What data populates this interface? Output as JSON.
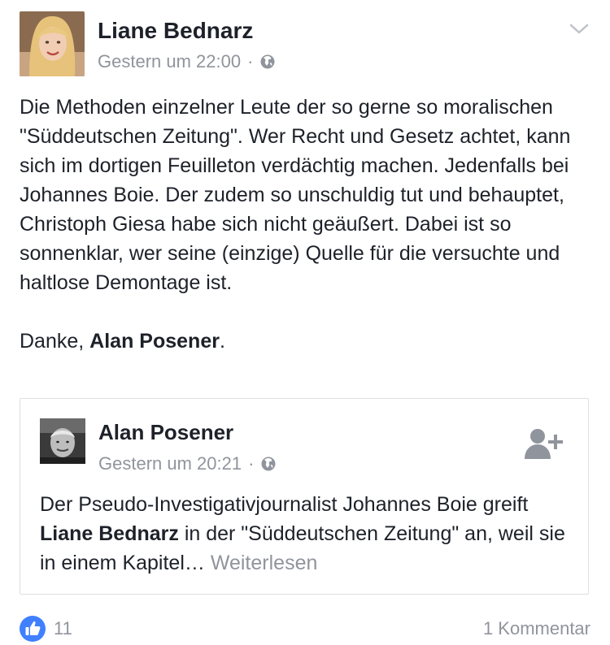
{
  "post": {
    "author": "Liane Bednarz",
    "timestamp": "Gestern um 22:00",
    "separator": "·",
    "privacy_icon": "globe-icon",
    "menu_icon": "chevron-down-icon",
    "body_paragraph_1": "Die Methoden einzelner Leute der so gerne so moralischen \"Süddeutschen Zeitung\". Wer Recht und Gesetz achtet, kann sich im dortigen Feuilleton verdächtig machen. Jedenfalls bei Johannes Boie. Der zudem so unschuldig tut und behauptet, Christoph Giesa habe sich nicht geäußert. Dabei ist so sonnenklar, wer seine (einzige) Quelle für die versuchte und haltlose Demontage ist.",
    "thanks_prefix": "Danke, ",
    "thanks_mention": "Alan Posener",
    "thanks_suffix": "."
  },
  "shared": {
    "author": "Alan Posener",
    "timestamp": "Gestern um 20:21",
    "separator": "·",
    "privacy_icon": "globe-icon",
    "add_friend_icon": "add-friend-icon",
    "text_prefix": "Der Pseudo-Investigativjournalist Johannes Boie greift ",
    "text_mention": "Liane Bednarz",
    "text_suffix": " in der \"Süddeutschen Zeitung\" an, weil sie in einem Kapitel… ",
    "see_more": "Weiterlesen"
  },
  "footer": {
    "like_icon": "thumbs-up-icon",
    "like_count": "11",
    "comment_count": "1 Kommentar"
  },
  "colors": {
    "text": "#1d2129",
    "secondary": "#90949c",
    "like_blue": "#4080ff",
    "border": "#dddfe2"
  }
}
